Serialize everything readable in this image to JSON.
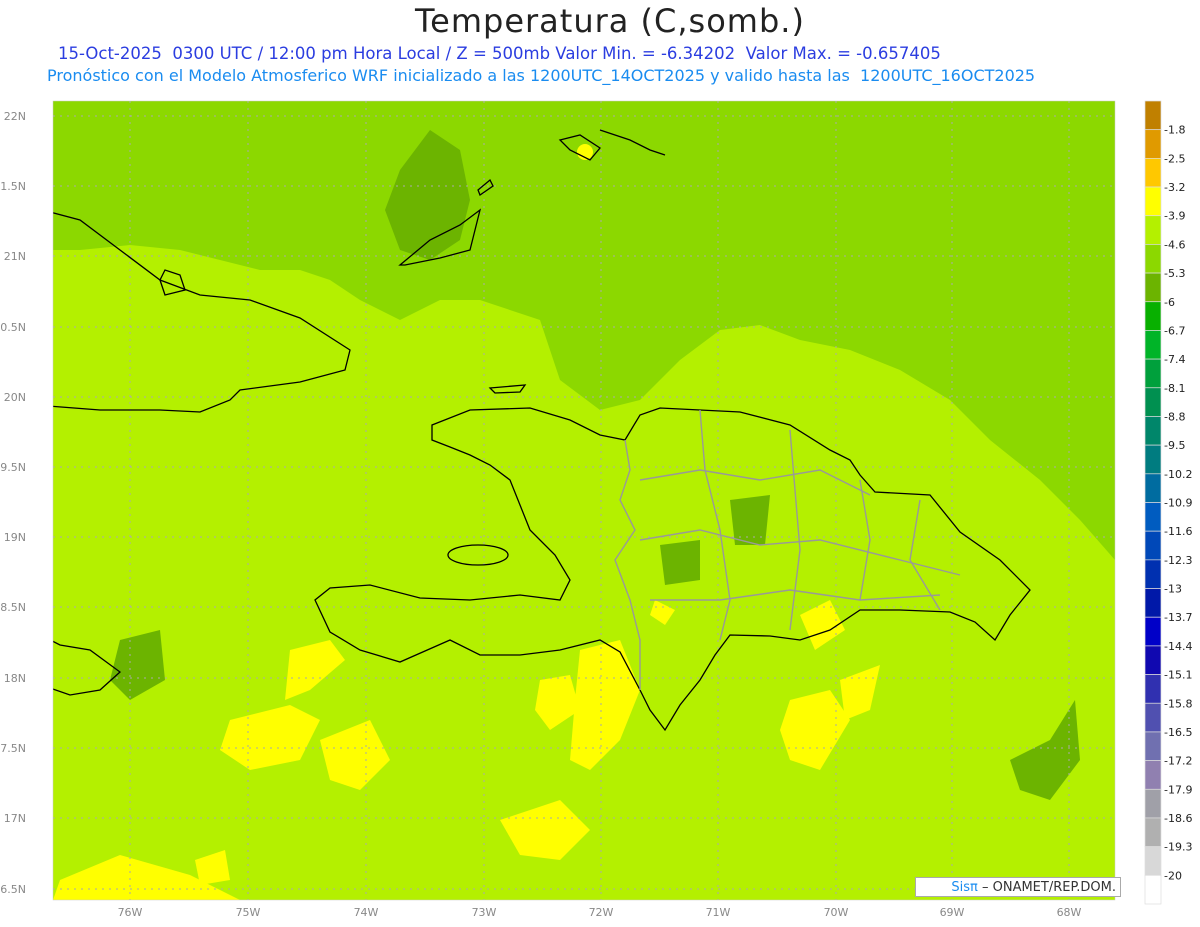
{
  "header": {
    "title": "Temperatura (C,somb.)",
    "line1": "15-Oct-2025  0300 UTC / 12:00 pm Hora Local / Z = 500mb Valor Min. = -6.34202  Valor Max. = -0.657405",
    "line2": "Pronóstico con el Modelo Atmosferico WRF inicializado a las 1200UTC_14OCT2025 y valido hasta las  1200UTC_16OCT2025"
  },
  "axes": {
    "lon_labels": [
      "76W",
      "75W",
      "74W",
      "73W",
      "72W",
      "71W",
      "70W",
      "69W",
      "68W"
    ],
    "lat_labels": [
      "22N",
      "1.5N",
      "21N",
      "0.5N",
      "20N",
      "9.5N",
      "19N",
      "8.5N",
      "18N",
      "7.5N",
      "17N",
      "6.5N"
    ]
  },
  "colorbar": {
    "labels": [
      "-1.8",
      "-2.5",
      "-3.2",
      "-3.9",
      "-4.6",
      "-5.3",
      "-6",
      "-6.7",
      "-7.4",
      "-8.1",
      "-8.8",
      "-9.5",
      "-10.2",
      "-10.9",
      "-11.6",
      "-12.3",
      "-13",
      "-13.7",
      "-14.4",
      "-15.1",
      "-15.8",
      "-16.5",
      "-17.2",
      "-17.9",
      "-18.6",
      "-19.3",
      "-20"
    ],
    "colors": [
      "#c08000",
      "#e09a00",
      "#ffc800",
      "#ffff00",
      "#b4f000",
      "#8cd800",
      "#6cb400",
      "#08b000",
      "#00b428",
      "#00a03c",
      "#009050",
      "#00866a",
      "#007c80",
      "#006ca0",
      "#005cc0",
      "#0048b8",
      "#0030b0",
      "#0018a8",
      "#0000c8",
      "#1008b0",
      "#3030b0",
      "#5050b0",
      "#7070b0",
      "#9080b0",
      "#a0a0a8",
      "#b0b0b0",
      "#d8d8d8",
      "#ffffff"
    ]
  },
  "logo": {
    "sis": "Sisπ",
    "text": " –  ONAMET/REP.DOM."
  }
}
